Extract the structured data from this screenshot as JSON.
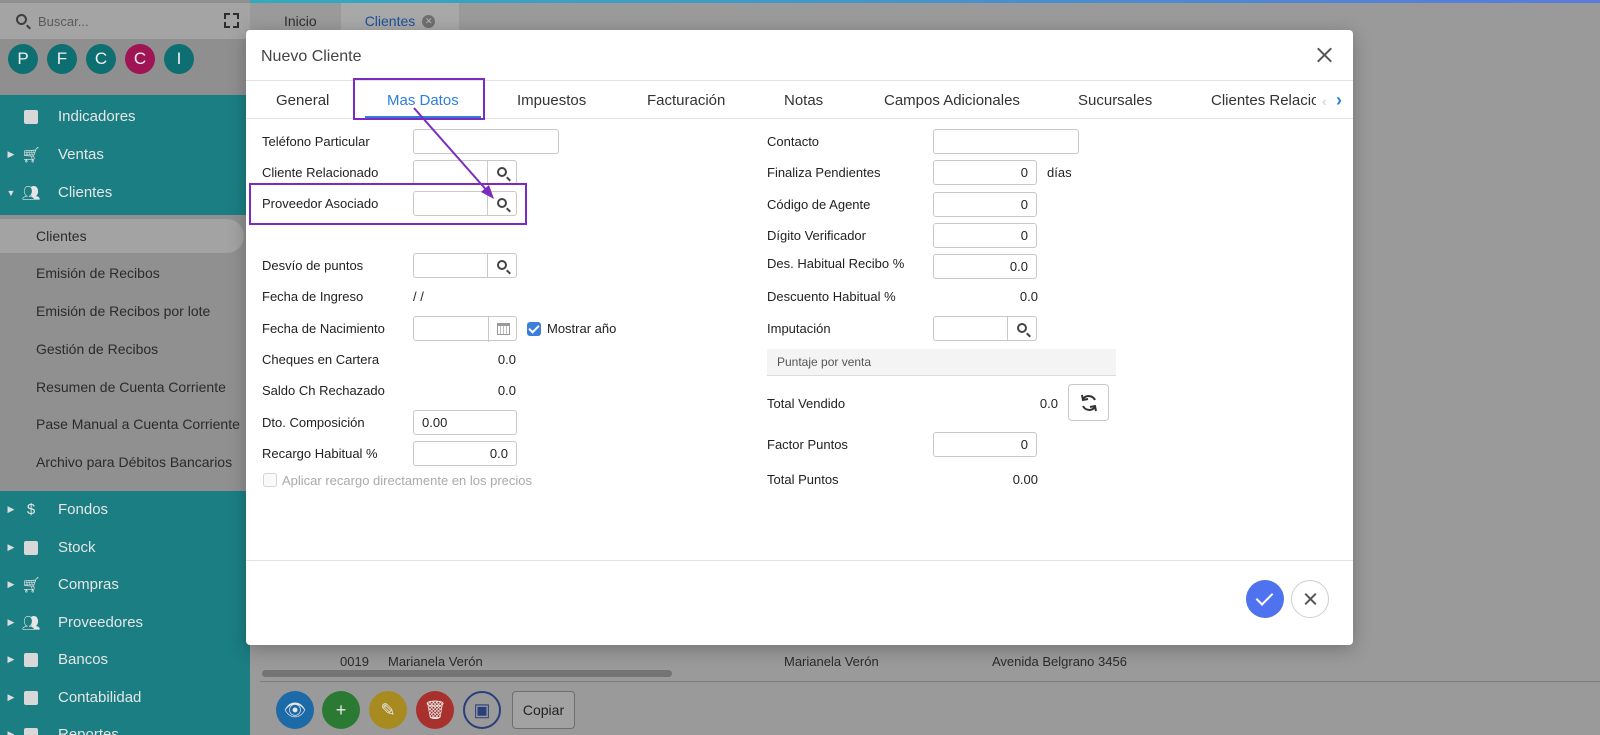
{
  "app": {
    "search_placeholder": "Buscar...",
    "avatars": [
      {
        "letter": "P",
        "color": "#0e6f72"
      },
      {
        "letter": "F",
        "color": "#0e6f72"
      },
      {
        "letter": "C",
        "color": "#0e6f72"
      },
      {
        "letter": "C",
        "color": "#a01456"
      },
      {
        "letter": "I",
        "color": "#0e6f72"
      }
    ],
    "menu": {
      "indicadores": "Indicadores",
      "ventas": "Ventas",
      "clientes": "Clientes",
      "sub": [
        "Clientes",
        "Emisión de Recibos",
        "Emisión de Recibos por lote",
        "Gestión de Recibos",
        "Resumen de Cuenta Corriente",
        "Pase Manual a Cuenta Corriente",
        "Archivo para Débitos Bancarios"
      ],
      "fondos": "Fondos",
      "stock": "Stock",
      "compras": "Compras",
      "proveedores": "Proveedores",
      "bancos": "Bancos",
      "contabilidad": "Contabilidad",
      "reportes": "Reportes"
    },
    "main_tabs": {
      "inicio": "Inicio",
      "clientes": "Clientes"
    },
    "bg_row": {
      "code": "0019",
      "name": "Marianela Verón",
      "name2": "Marianela Verón",
      "address": "Avenida Belgrano 3456"
    },
    "copy_label": "Copiar"
  },
  "modal": {
    "title": "Nuevo Cliente",
    "tabs": [
      "General",
      "Mas Datos",
      "Impuestos",
      "Facturación",
      "Notas",
      "Campos Adicionales",
      "Sucursales",
      "Clientes Relacionados"
    ],
    "left": {
      "telefono_label": "Teléfono Particular",
      "cliente_rel_label": "Cliente Relacionado",
      "proveedor_label": "Proveedor Asociado",
      "desvio_label": "Desvío de puntos",
      "fecha_ingreso_label": "Fecha de Ingreso",
      "fecha_ingreso_value": "/ /",
      "fecha_nac_label": "Fecha de Nacimiento",
      "mostrar_anio_label": "Mostrar año",
      "cheques_label": "Cheques en Cartera",
      "cheques_value": "0.0",
      "saldo_label": "Saldo Ch Rechazado",
      "saldo_value": "0.0",
      "dto_label": "Dto. Composición",
      "dto_value": "0.00",
      "recargo_label": "Recargo Habitual %",
      "recargo_value": "0.0",
      "aplicar_label": "Aplicar recargo directamente en los precios"
    },
    "right": {
      "contacto_label": "Contacto",
      "finaliza_label": "Finaliza Pendientes",
      "finaliza_value": "0",
      "dias_label": "días",
      "agente_label": "Código de Agente",
      "agente_value": "0",
      "digito_label": "Dígito Verificador",
      "digito_value": "0",
      "des_recibo_label": "Des. Habitual Recibo %",
      "des_recibo_value": "0.0",
      "descuento_label": "Descuento Habitual %",
      "descuento_value": "0.0",
      "imputacion_label": "Imputación",
      "puntaje_section": "Puntaje por venta",
      "total_vendido_label": "Total Vendido",
      "total_vendido_value": "0.0",
      "factor_label": "Factor Puntos",
      "factor_value": "0",
      "total_puntos_label": "Total Puntos",
      "total_puntos_value": "0.00"
    },
    "annotation_color": "#7b2cbf",
    "accent": "#2f7fd8"
  }
}
